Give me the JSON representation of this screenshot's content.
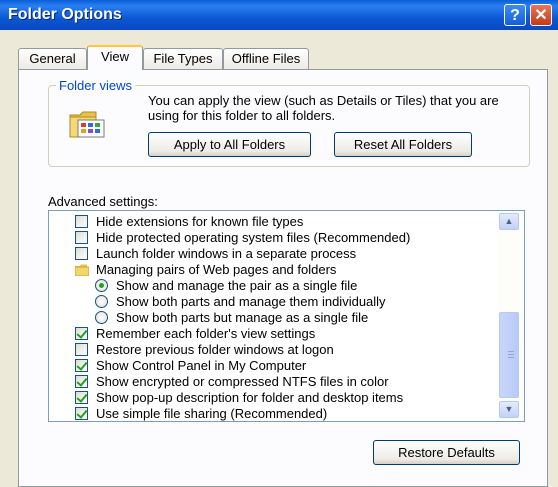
{
  "window": {
    "title": "Folder Options",
    "help_label": "?",
    "close_label": "✕"
  },
  "tabs": [
    {
      "label": "General"
    },
    {
      "label": "View"
    },
    {
      "label": "File Types"
    },
    {
      "label": "Offline Files"
    }
  ],
  "folder_views": {
    "label": "Folder views",
    "description": "You can apply the view (such as Details or Tiles) that you are using for this folder to all folders.",
    "apply_button": "Apply to All Folders",
    "reset_button": "Reset All Folders"
  },
  "advanced": {
    "label": "Advanced settings:",
    "items": [
      {
        "type": "checkbox",
        "checked": false,
        "label": "Hide extensions for known file types"
      },
      {
        "type": "checkbox",
        "checked": false,
        "label": "Hide protected operating system files (Recommended)"
      },
      {
        "type": "checkbox",
        "checked": false,
        "label": "Launch folder windows in a separate process"
      },
      {
        "type": "folder",
        "label": "Managing pairs of Web pages and folders"
      },
      {
        "type": "radio",
        "checked": true,
        "label": "Show and manage the pair as a single file"
      },
      {
        "type": "radio",
        "checked": false,
        "label": "Show both parts and manage them individually"
      },
      {
        "type": "radio",
        "checked": false,
        "label": "Show both parts but manage as a single file"
      },
      {
        "type": "checkbox",
        "checked": true,
        "label": "Remember each folder's view settings"
      },
      {
        "type": "checkbox",
        "checked": false,
        "label": "Restore previous folder windows at logon"
      },
      {
        "type": "checkbox",
        "checked": true,
        "label": "Show Control Panel in My Computer"
      },
      {
        "type": "checkbox",
        "checked": true,
        "label": "Show encrypted or compressed NTFS files in color"
      },
      {
        "type": "checkbox",
        "checked": true,
        "label": "Show pop-up description for folder and desktop items"
      },
      {
        "type": "checkbox",
        "checked": true,
        "label": "Use simple file sharing (Recommended)"
      }
    ]
  },
  "restore_defaults_button": "Restore Defaults",
  "colors": {
    "title_bar": "#0a5fd8",
    "group_label": "#0046d5",
    "check_green": "#21a121",
    "dialog_bg": "#ece9d8"
  }
}
